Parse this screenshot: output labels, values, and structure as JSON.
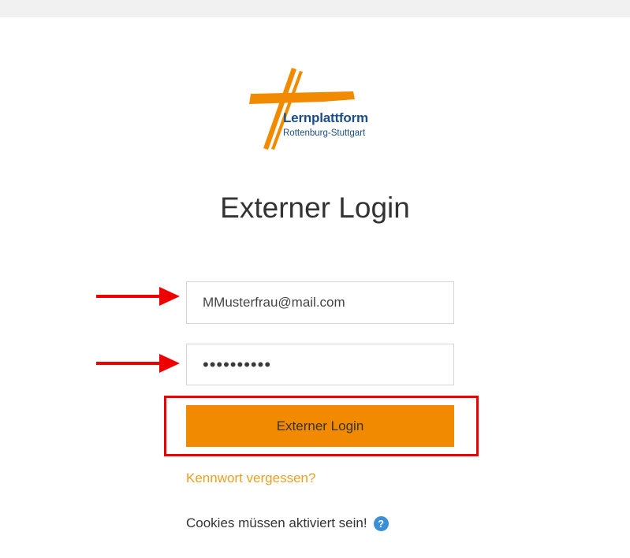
{
  "logo": {
    "name": "Lernplattform",
    "subtitle": "Rottenburg-Stuttgart",
    "brand_color": "#f28a00",
    "text_color": "#1d4f84"
  },
  "page": {
    "title": "Externer Login"
  },
  "form": {
    "username_value": "MMusterfrau@mail.com",
    "password_value": "••••••••••",
    "login_button_label": "Externer Login",
    "forgot_password_label": "Kennwort vergessen?",
    "cookies_notice": "Cookies müssen aktiviert sein!",
    "help_icon_glyph": "?"
  },
  "annotations": {
    "arrow_color": "#ee0000",
    "highlight_color": "#ee0000"
  },
  "icons": {
    "help": "help-icon",
    "arrows": "arrow-right-icon"
  }
}
